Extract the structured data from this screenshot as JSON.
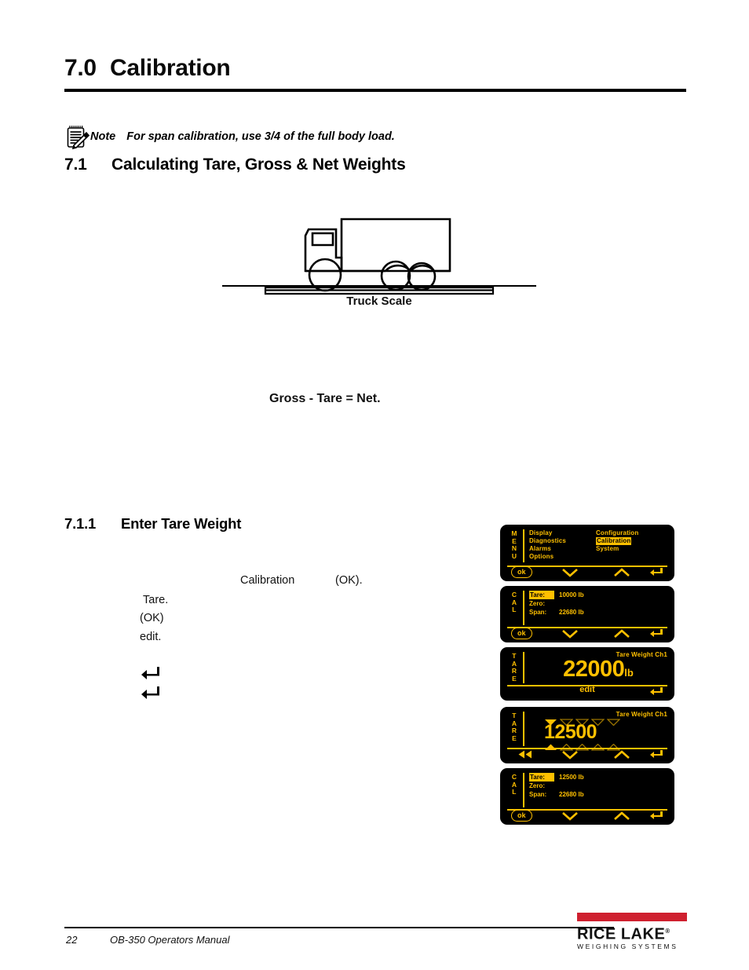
{
  "document": {
    "section_70": {
      "number": "7.0",
      "title": "Calibration"
    },
    "note": {
      "label": "Note",
      "text": "For span calibration, use 3/4 of the full body load."
    },
    "section_71": {
      "number": "7.1",
      "title": "Calculating Tare, Gross & Net Weights"
    },
    "figure": {
      "caption": "Truck Scale"
    },
    "equation": "Gross - Tare = Net.",
    "section_711": {
      "number": "7.1.1",
      "title": "Enter Tare Weight"
    },
    "fragments": {
      "calibration": "Calibration",
      "ok_period": "(OK).",
      "tare": "Tare.",
      "ok": "(OK)",
      "edit": "edit."
    }
  },
  "screens": [
    {
      "mode": "MENU",
      "mode_chars": [
        "M",
        "E",
        "N",
        "U"
      ],
      "left_items": [
        "Display",
        "Diagnostics",
        "Alarms",
        "Options"
      ],
      "right_items": [
        "Configuration",
        "Calibration",
        "System"
      ],
      "highlighted": "Calibration",
      "footer": {
        "ok": "ok",
        "icons": [
          "chevron-down",
          "chevron-up",
          "return"
        ]
      }
    },
    {
      "mode": "CAL",
      "mode_chars": [
        "C",
        "A",
        "L"
      ],
      "rows": [
        {
          "key": "Tare:",
          "value": "10000 lb",
          "highlight": true
        },
        {
          "key": "Zero:",
          "value": "",
          "highlight": false
        },
        {
          "key": "Span:",
          "value": "22680 lb",
          "highlight": false
        }
      ],
      "footer": {
        "ok": "ok",
        "icons": [
          "chevron-down",
          "chevron-up",
          "return"
        ]
      }
    },
    {
      "mode": "TARE",
      "mode_chars": [
        "T",
        "A",
        "R",
        "E"
      ],
      "header": "Tare Weight Ch1",
      "value": "22000",
      "unit": "lb",
      "footer": {
        "edit": "edit",
        "icons": [
          "return"
        ]
      }
    },
    {
      "mode": "TARE",
      "mode_chars": [
        "T",
        "A",
        "R",
        "E"
      ],
      "header": "Tare Weight Ch1",
      "digits": [
        "1",
        "2",
        "5",
        "0",
        "0"
      ],
      "selected_index": 0,
      "footer": {
        "icons": [
          "rewind",
          "chevron-down",
          "chevron-up",
          "return"
        ]
      }
    },
    {
      "mode": "CAL",
      "mode_chars": [
        "C",
        "A",
        "L"
      ],
      "rows": [
        {
          "key": "Tare:",
          "value": "12500 lb",
          "highlight": true
        },
        {
          "key": "Zero:",
          "value": "",
          "highlight": false
        },
        {
          "key": "Span:",
          "value": "22680 lb",
          "highlight": false
        }
      ],
      "footer": {
        "ok": "ok",
        "icons": [
          "chevron-down",
          "chevron-up",
          "return"
        ]
      }
    }
  ],
  "footer": {
    "page_number": "22",
    "manual_title": "OB-350 Operators Manual",
    "logo_name": "RICE LAKE",
    "logo_sub": "WEIGHING SYSTEMS"
  },
  "colors": {
    "display_amber": "#ffc000",
    "display_background": "#000000",
    "brand_red": "#cf202f"
  }
}
